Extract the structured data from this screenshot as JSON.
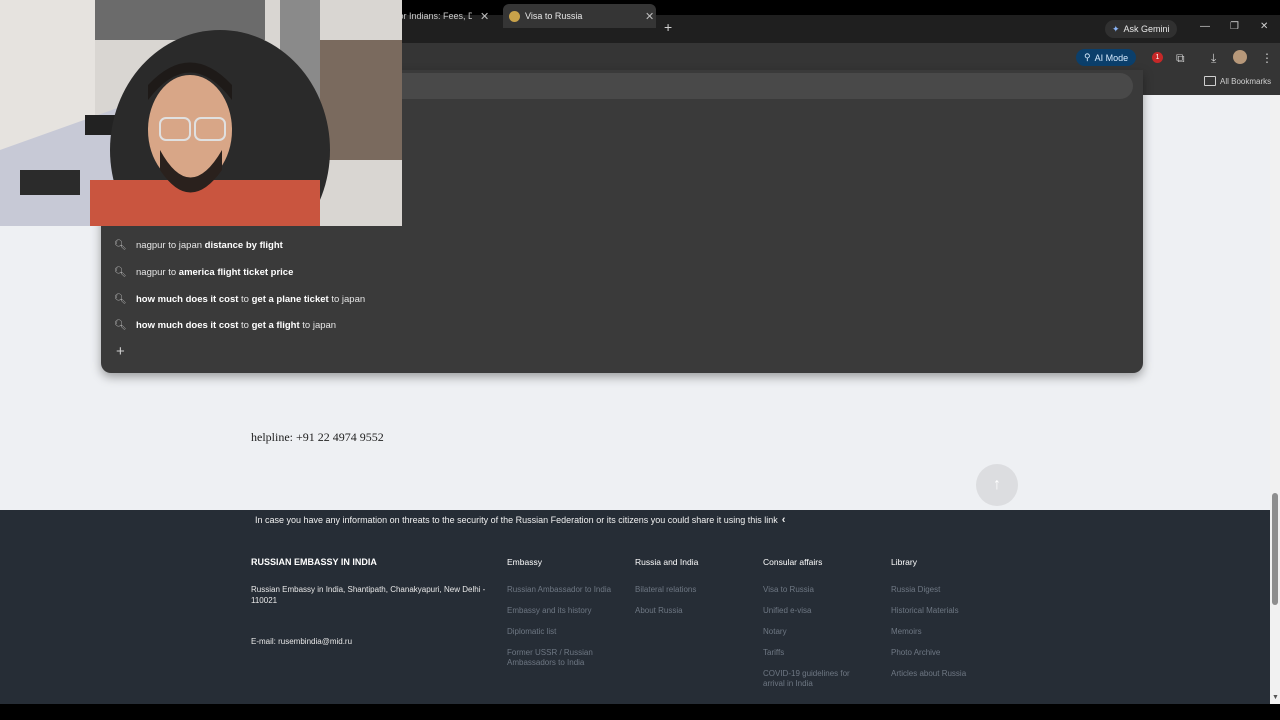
{
  "browser": {
    "tabs": [
      {
        "title": "for Indians: Fees, Du",
        "active": false
      },
      {
        "title": "Visa to Russia",
        "active": true
      }
    ],
    "ask_gemini": "Ask Gemini",
    "ai_mode": "AI Mode",
    "extension_badge": "1",
    "all_bookmarks": "All Bookmarks",
    "icons": {
      "minimize": "minimize-icon",
      "restore": "restore-icon",
      "close": "close-icon",
      "download": "download-icon",
      "extensions": "puzzle-icon",
      "menu": "kebab-menu-icon"
    }
  },
  "omnibox": {
    "suggestions": [
      {
        "plain": "nagpur to japan ",
        "bold": "distance by flight",
        "tail": ""
      },
      {
        "plain": "nagpur to ",
        "bold": "america flight ticket price",
        "tail": ""
      },
      {
        "plain": "",
        "bold": "how much does it cost",
        "mid": " to ",
        "bold2": "get a plane ticket",
        "tail": " to japan"
      },
      {
        "plain": "",
        "bold": "how much does it cost",
        "mid": " to ",
        "bold2": "get a flight",
        "tail": " to japan"
      }
    ]
  },
  "page": {
    "helpline": "helpline: +91 22 4974 9552"
  },
  "footer": {
    "threat_notice": "In case you have any information on threats to the security of the Russian Federation or its citizens you could share it using this link",
    "embassy_title": "RUSSIAN EMBASSY IN INDIA",
    "embassy_address": "Russian Embassy in India, Shantipath, Chanakyapuri, New Delhi - 110021",
    "embassy_email": "E-mail: rusembindia@mid.ru",
    "columns": [
      {
        "heading": "Embassy",
        "links": [
          "Russian Ambassador to India",
          "Embassy and its history",
          "Diplomatic list",
          "Former USSR / Russian Ambassadors to India"
        ]
      },
      {
        "heading": "Russia and India",
        "links": [
          "Bilateral relations",
          "About Russia"
        ]
      },
      {
        "heading": "Consular affairs",
        "links": [
          "Visa to Russia",
          "Unified e-visa",
          "Notary",
          "Tariffs",
          "COVID-19 guidelines for arrival in India"
        ]
      },
      {
        "heading": "Library",
        "links": [
          "Russia Digest",
          "Historical Materials",
          "Memoirs",
          "Photo Archive",
          "Articles about Russia"
        ]
      }
    ]
  }
}
